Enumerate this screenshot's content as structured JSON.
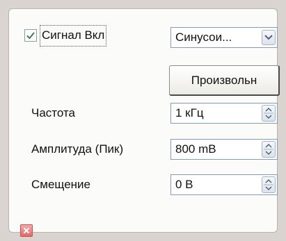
{
  "signal": {
    "enabled_label": "Сигнал Вкл",
    "enabled": true,
    "waveform_value": "Синусои..."
  },
  "custom_button_label": "Произвольн",
  "fields": [
    {
      "label": "Частота",
      "value": "1 кГц"
    },
    {
      "label": "Амплитуда (Пик)",
      "value": "800 mB"
    },
    {
      "label": "Смещение",
      "value": "0 В"
    }
  ],
  "icons": {
    "checkbox": "checkmark-icon",
    "combo": "chevron-down-icon",
    "spin": "spin-arrows-icon",
    "close": "close-icon"
  },
  "colors": {
    "close_red": "#e46a6a",
    "check_green": "#3f7f3f"
  }
}
